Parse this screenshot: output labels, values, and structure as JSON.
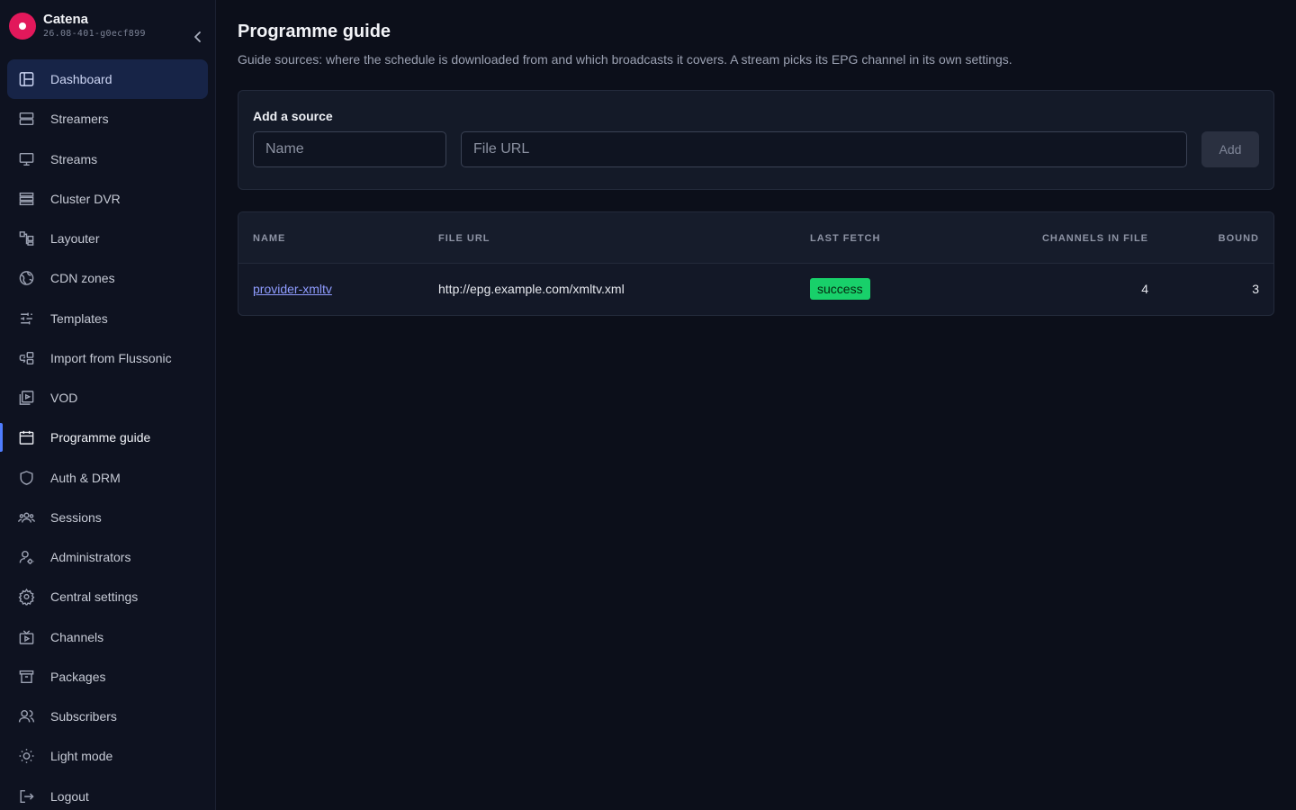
{
  "app": {
    "name": "Catena",
    "version": "26.08-401-g0ecf899"
  },
  "sidebar": {
    "items": [
      {
        "label": "Dashboard",
        "icon": "dashboard-icon"
      },
      {
        "label": "Streamers",
        "icon": "server-icon"
      },
      {
        "label": "Streams",
        "icon": "monitor-icon"
      },
      {
        "label": "Cluster DVR",
        "icon": "list-icon"
      },
      {
        "label": "Layouter",
        "icon": "layout-icon"
      },
      {
        "label": "CDN zones",
        "icon": "globe-icon"
      },
      {
        "label": "Templates",
        "icon": "sliders-icon"
      },
      {
        "label": "Import from Flussonic",
        "icon": "import-icon"
      },
      {
        "label": "VOD",
        "icon": "vod-icon"
      },
      {
        "label": "Programme guide",
        "icon": "calendar-icon"
      },
      {
        "label": "Auth & DRM",
        "icon": "shield-icon"
      },
      {
        "label": "Sessions",
        "icon": "users-group-icon"
      },
      {
        "label": "Administrators",
        "icon": "user-gear-icon"
      },
      {
        "label": "Central settings",
        "icon": "gear-icon"
      },
      {
        "label": "Channels",
        "icon": "tv-icon"
      },
      {
        "label": "Packages",
        "icon": "archive-icon"
      },
      {
        "label": "Subscribers",
        "icon": "users-icon"
      },
      {
        "label": "Light mode",
        "icon": "sun-icon"
      },
      {
        "label": "Logout",
        "icon": "logout-icon"
      }
    ]
  },
  "page": {
    "title": "Programme guide",
    "subtitle": "Guide sources: where the schedule is downloaded from and which broadcasts it covers. A stream picks its EPG channel in its own settings."
  },
  "add_source": {
    "title": "Add a source",
    "name_placeholder": "Name",
    "url_placeholder": "File URL",
    "add_label": "Add"
  },
  "table": {
    "headers": {
      "name": "NAME",
      "file_url": "FILE URL",
      "last_fetch": "LAST FETCH",
      "channels_in_file": "CHANNELS IN FILE",
      "bound": "BOUND"
    },
    "rows": [
      {
        "name": "provider-xmltv",
        "file_url": "http://epg.example.com/xmltv.xml",
        "last_fetch": "success",
        "channels_in_file": "4",
        "bound": "3"
      }
    ]
  },
  "colors": {
    "accent": "#4f7dff",
    "success": "#18d06a",
    "brand": "#e2185b"
  }
}
